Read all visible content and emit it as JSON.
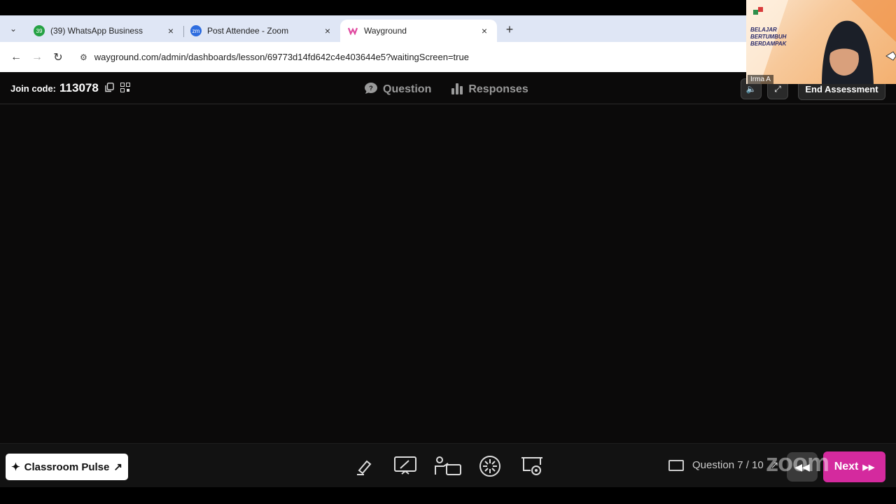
{
  "browser": {
    "tabs": [
      {
        "title": "(39) WhatsApp Business",
        "favicon_text": "39",
        "favicon_color": "#25a244",
        "active": false
      },
      {
        "title": "Post Attendee - Zoom",
        "favicon_text": "zm",
        "favicon_color": "#2d6cdf",
        "active": false
      },
      {
        "title": "Wayground",
        "favicon_text": "",
        "favicon_color": "#e0489f",
        "active": true
      }
    ],
    "url": "wayground.com/admin/dashboards/lesson/69773d14fd642c4e403644e5?waitingScreen=true"
  },
  "header": {
    "join_label": "Join code:",
    "join_code": "113078",
    "tabs": [
      {
        "label": "Question",
        "icon": "chat-bubble-icon"
      },
      {
        "label": "Responses",
        "icon": "bar-chart-icon"
      }
    ],
    "end_label": "End Assessment"
  },
  "footer": {
    "pulse_label": "Classroom Pulse",
    "tools": [
      "highlighter-icon",
      "presentation-edit-icon",
      "teacher-board-icon",
      "power-up-icon",
      "hidden-answers-icon"
    ],
    "question_counter": "Question 7 / 10",
    "next_label": "Next"
  },
  "zoom": {
    "watermark": "zoom",
    "participant_name": "Irma A",
    "banner_lines": [
      "BELAJAR",
      "BERTUMBUH",
      "BERDAMPAK"
    ]
  },
  "colors": {
    "accent": "#d42a9e",
    "background": "#0b0a0a"
  }
}
